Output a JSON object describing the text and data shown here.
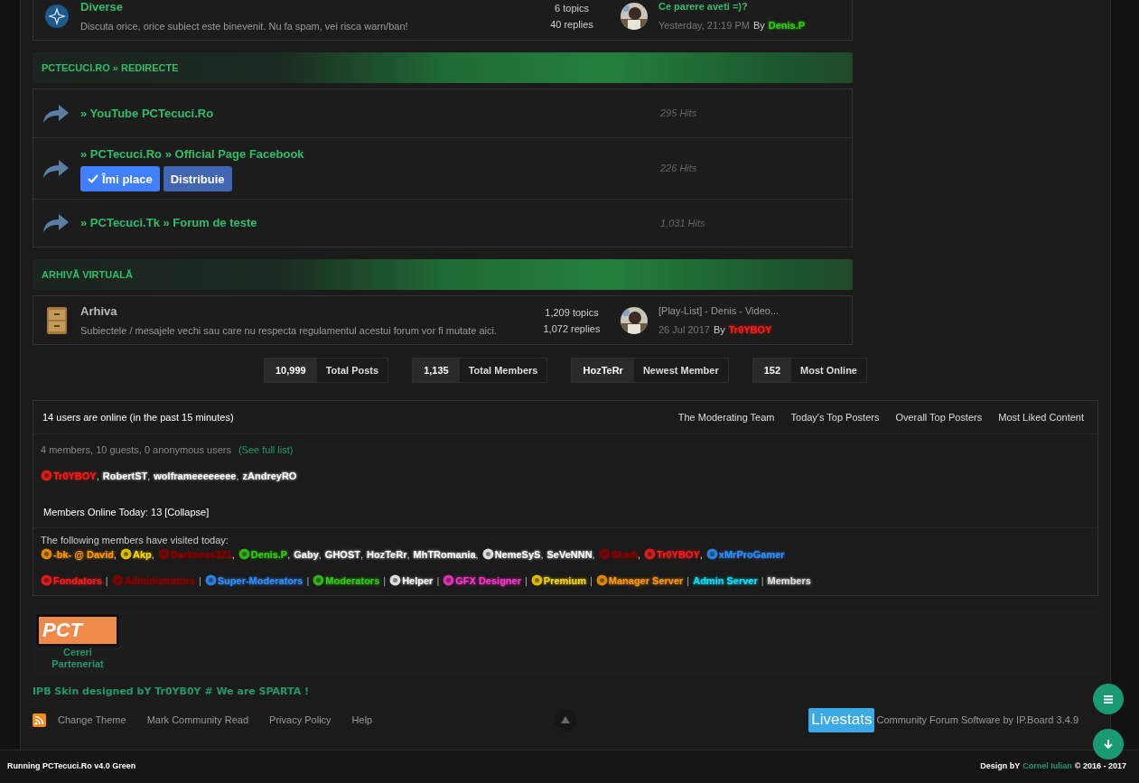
{
  "top_forum": {
    "title": "Diverse",
    "unread": true,
    "description": "Discuta orice, orice subiect este binevenit. Nu fa spam, vei risca warn/ban!",
    "topics": "6 topics",
    "replies": "40 replies",
    "last_post": {
      "title": "Ce parere aveti =)?",
      "date": "Yesterday, 21:19 PM",
      "by": "By",
      "author": "Denis.P",
      "color": "#33cc11"
    }
  },
  "redirect_category": {
    "title": "PCTECUCI.RO » REDIRECTE",
    "links": [
      {
        "title": "» YouTube PCTecuci.Ro",
        "hits": "295 Hits"
      },
      {
        "title": "» PCTecuci.Ro » Official Page Facebook",
        "hits": "226 Hits",
        "buttons": [
          {
            "label": "Îmi place",
            "kind": "like"
          },
          {
            "label": "Distribuie",
            "kind": "share"
          }
        ]
      },
      {
        "title": "» PCTecuci.Tk » Forum de teste",
        "hits": "1,031 Hits"
      }
    ]
  },
  "archive_category": {
    "title": "ARHIVĂ VIRTUALĂ",
    "forum": {
      "title": "Arhiva",
      "unread": false,
      "description": "Subiectele / mesajele vechi sau care nu respecta regulamentul acestui forum vor fi mutate aici.",
      "topics": "1,209 topics",
      "replies": "1,072 replies",
      "last_post": {
        "title": "[Play-List] - Denis - Video...",
        "date": "26 Jul 2017",
        "by": "By",
        "author": "Tr0YBOY",
        "color": "#ff1a1a"
      }
    }
  },
  "stats": [
    {
      "value": "10,999",
      "label": "Total Posts"
    },
    {
      "value": "1,135",
      "label": "Total Members"
    },
    {
      "value": "HozTeRr",
      "label": "Newest Member"
    },
    {
      "value": "152",
      "label": "Most Online"
    }
  ],
  "online": {
    "title": "14 users are online (in the past 15 minutes)",
    "links": [
      "The Moderating Team",
      "Today's Top Posters",
      "Overall Top Posters",
      "Most Liked Content"
    ],
    "summary": "4 members, 10 guests, 0 anonymous users",
    "see_full": "(See full list)",
    "separator": ",",
    "users": [
      {
        "name": "Tr0YBOY",
        "color": "#ff1a1a",
        "badge": true
      },
      {
        "name": "RobertST",
        "color": "#ffffff",
        "badge": false
      },
      {
        "name": "wolframeeeeeeee",
        "color": "#ffffff",
        "badge": false
      },
      {
        "name": "zAndreyRO",
        "color": "#ffffff",
        "badge": false
      }
    ],
    "today": "Members Online Today: 13 [Collapse]",
    "visited_title": "The following members have visited today:",
    "visited": [
      {
        "name": "-bk- @ David",
        "color": "#ff9900",
        "badge": true
      },
      {
        "name": "Akp",
        "color": "#ffd700",
        "badge": true
      },
      {
        "name": "Darkness321",
        "color": "#8b0000",
        "badge": true
      },
      {
        "name": "Denis.P",
        "color": "#33cc11",
        "badge": true
      },
      {
        "name": "Gaby",
        "color": "#ffffff",
        "badge": false
      },
      {
        "name": "GHOST",
        "color": "#ffffff",
        "badge": false
      },
      {
        "name": "HozTeRr",
        "color": "#ffffff",
        "badge": false
      },
      {
        "name": "MhTRomania",
        "color": "#ffffff",
        "badge": false
      },
      {
        "name": "NemeSyS",
        "color": "#ffffff",
        "badge": true
      },
      {
        "name": "SeVeNNN",
        "color": "#ffffff",
        "badge": false
      },
      {
        "name": "Skadi",
        "color": "#8b0000",
        "badge": true
      },
      {
        "name": "Tr0YBOY",
        "color": "#ff1a1a",
        "badge": true
      },
      {
        "name": "xMrProGamer",
        "color": "#2f8fff",
        "badge": true
      }
    ],
    "legend_separator": "|",
    "groups": [
      {
        "name": "Fondators",
        "color": "#ff1a1a",
        "badge": true
      },
      {
        "name": "Administrators",
        "color": "#8b0000",
        "badge": true
      },
      {
        "name": "Super-Moderators",
        "color": "#2f8fff",
        "badge": true
      },
      {
        "name": "Moderators",
        "color": "#33cc11",
        "badge": true
      },
      {
        "name": "Helper",
        "color": "#ffffff",
        "badge": true
      },
      {
        "name": "GFX Designer",
        "color": "#ff33cc",
        "badge": true
      },
      {
        "name": "Premium",
        "color": "#ffd700",
        "badge": true
      },
      {
        "name": "Manager Server",
        "color": "#ff9900",
        "badge": true
      },
      {
        "name": "Admin Server",
        "color": "#00e5ff",
        "badge": false
      },
      {
        "name": "Members",
        "color": "#dddddd",
        "badge": false
      }
    ]
  },
  "partner": {
    "logo": "PCT",
    "label": "Cereri Parteneriat"
  },
  "footer": {
    "credit": "IPB Skin designed bY Tr0YB0Y # We are SPARTA !",
    "links": [
      "Change Theme",
      "Mark Community Read",
      "Privacy Policy",
      "Help"
    ],
    "stats_logo": "Livestats",
    "software": "Community Forum Software by IP.Board 3.4.9"
  },
  "bottom_bar": {
    "running": "Running PCTecuci.Ro v4.0 Green",
    "design_by": "Design bY",
    "designer": "Cornel Iulian",
    "years": "© 2016 - 2017"
  }
}
